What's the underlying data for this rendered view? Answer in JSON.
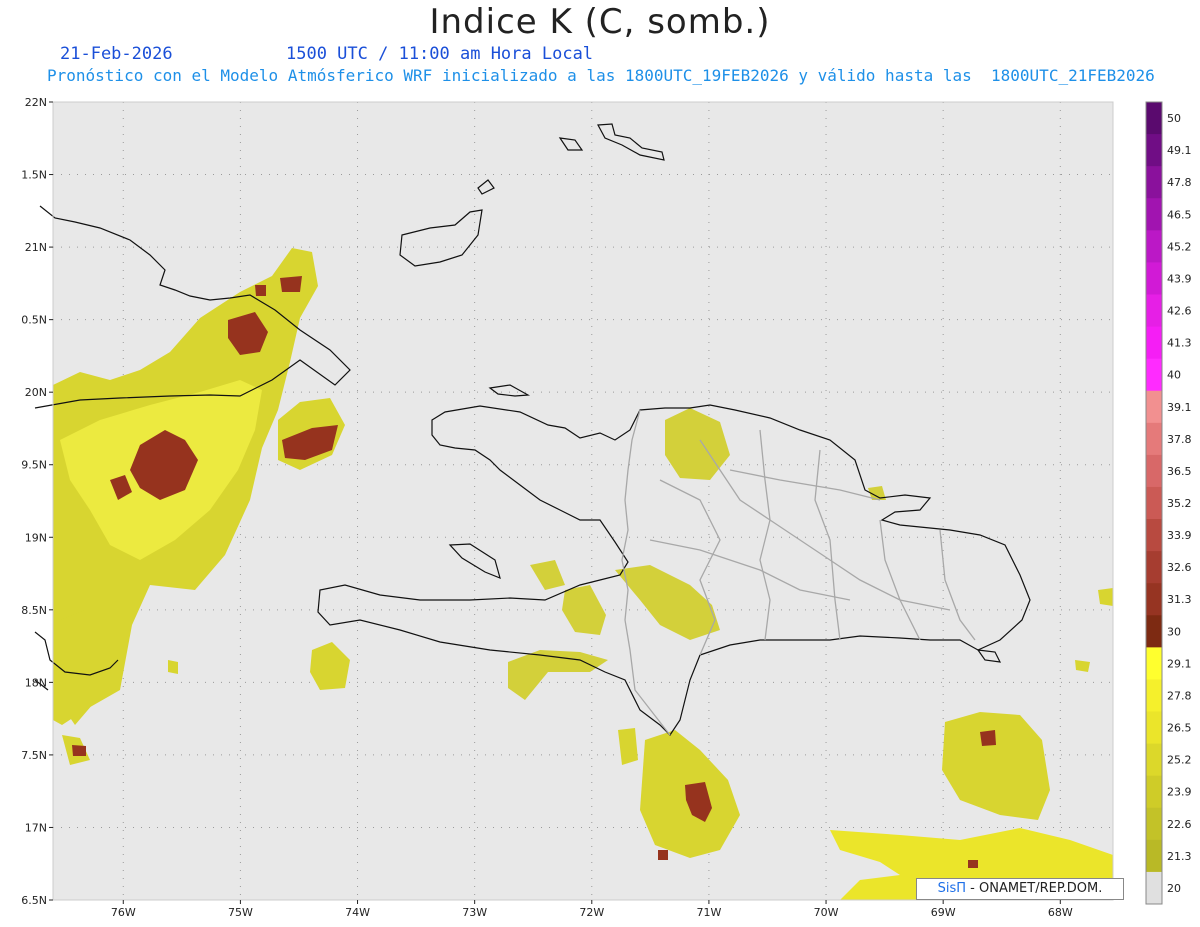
{
  "header": {
    "title": "Indice K (C, somb.)",
    "date": "21-Feb-2026",
    "time": "1500 UTC / 11:00 am Hora Local",
    "subtitle": "Pronóstico con el Modelo Atmósferico WRF inicializado a las 1800UTC_19FEB2026 y válido hasta las  1800UTC_21FEB2026"
  },
  "map": {
    "lat_labels": [
      "22N",
      "1.5N",
      "21N",
      "0.5N",
      "20N",
      "9.5N",
      "19N",
      "8.5N",
      "18N",
      "7.5N",
      "17N",
      "6.5N"
    ],
    "lon_labels": [
      "76W",
      "75W",
      "74W",
      "73W",
      "72W",
      "71W",
      "70W",
      "69W",
      "68W"
    ],
    "lat_range": [
      16.5,
      22
    ],
    "lon_range": [
      -76.6,
      -67.55
    ],
    "grid": true,
    "colors": {
      "ocean": "#e8e8e8",
      "coast": "#111111",
      "borders": "#999999"
    }
  },
  "colorbar": {
    "levels": [
      "50",
      "49.1",
      "47.8",
      "46.5",
      "45.2",
      "43.9",
      "42.6",
      "41.3",
      "40",
      "39.1",
      "37.8",
      "36.5",
      "35.2",
      "33.9",
      "32.6",
      "31.3",
      "30",
      "29.1",
      "27.8",
      "26.5",
      "25.2",
      "23.9",
      "22.6",
      "21.3",
      "20"
    ],
    "colors": [
      "#5a0a6e",
      "#700d85",
      "#8a119c",
      "#a114b0",
      "#bb18c6",
      "#d11ad6",
      "#e61fe6",
      "#f51ef5",
      "#ff2bff",
      "#f29090",
      "#e57a7a",
      "#d86868",
      "#cb5a55",
      "#b84a40",
      "#a63d30",
      "#963422",
      "#7d2a12",
      "#ffff2e",
      "#f5f02c",
      "#ebe52a",
      "#dcd82a",
      "#cfcc28",
      "#c3c228",
      "#b9b926",
      "#e0e0e0"
    ]
  },
  "credit": {
    "brand": "SisΠ",
    "text": " - ONAMET/REP.DOM."
  }
}
